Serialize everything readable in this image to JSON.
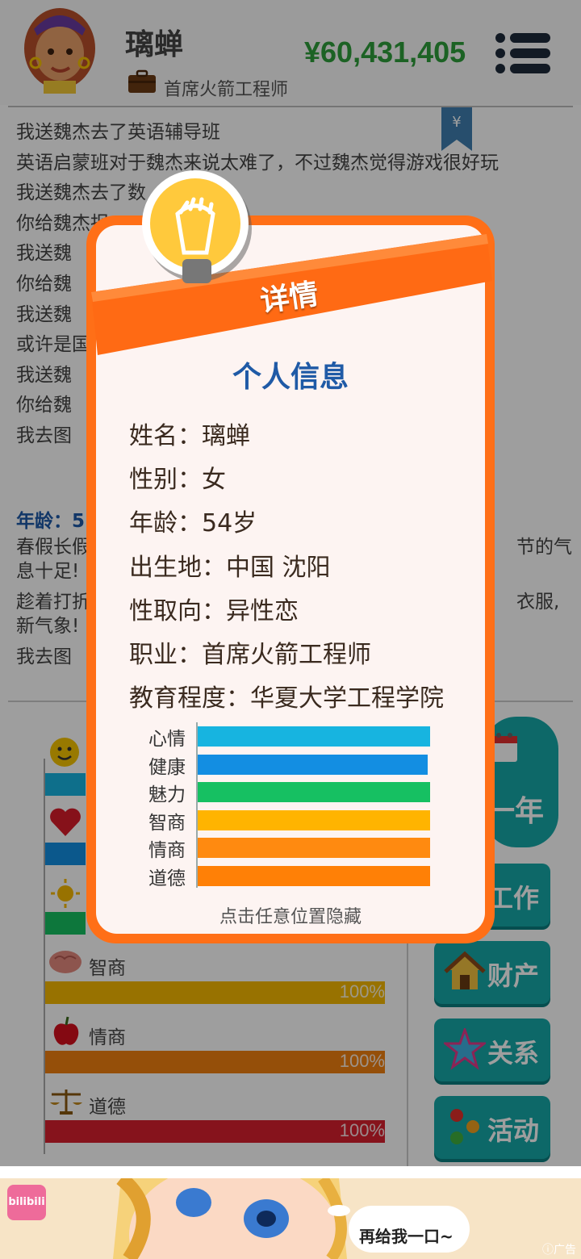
{
  "header": {
    "player_name": "璃蝉",
    "job_title": "首席火箭工程师",
    "money": "¥60,431,405",
    "icons": [
      "avatar",
      "briefcase-icon",
      "menu-icon"
    ]
  },
  "log": {
    "lines": [
      "我送魏杰去了英语辅导班",
      "英语启蒙班对于魏杰来说太难了，不过魏杰觉得游戏很好玩",
      "我送魏杰去了数",
      "你给魏杰报",
      "我送魏",
      "你给魏",
      "我送魏",
      "或许是国",
      "我送魏",
      "你给魏",
      "我去图"
    ],
    "age_title": "年龄：5",
    "paragraphs": [
      {
        "left": "春假长假",
        "right": "节的气",
        "line2": "息十足!"
      },
      {
        "left": "趁着打折",
        "right": "衣服,",
        "line2": "新气象!"
      },
      {
        "left": "我去图",
        "right": "",
        "line2": ""
      }
    ]
  },
  "stats": [
    {
      "label": "智商",
      "value": "100%",
      "color": "#f5b800",
      "icon": "brain-icon"
    },
    {
      "label": "情商",
      "value": "100%",
      "color": "#f08010",
      "icon": "apple-icon"
    },
    {
      "label": "道德",
      "value": "100%",
      "color": "#d8202e",
      "icon": "scales-icon"
    }
  ],
  "side_buttons": {
    "next_year": "一年",
    "work": "工作",
    "assets": "财产",
    "relations": "关系",
    "activities": "活动"
  },
  "modal": {
    "ribbon": "详情",
    "section_title": "个人信息",
    "info": [
      "姓名：璃蝉",
      "性别：女",
      "年龄：54岁",
      "出生地：中国 沈阳",
      "性取向：异性恋",
      "职业：首席火箭工程师",
      "教育程度：华夏大学工程学院"
    ],
    "bars": [
      {
        "label": "心情",
        "fraction": 1.0,
        "color": "#17b4e0"
      },
      {
        "label": "健康",
        "fraction": 0.99,
        "color": "#138ee2"
      },
      {
        "label": "魅力",
        "fraction": 1.0,
        "color": "#16c062"
      },
      {
        "label": "智商",
        "fraction": 1.0,
        "color": "#ffb400"
      },
      {
        "label": "情商",
        "fraction": 1.0,
        "color": "#ff8a10"
      },
      {
        "label": "道德",
        "fraction": 1.0,
        "color": "#ff8006"
      }
    ],
    "hint": "点击任意位置隐藏"
  },
  "ad": {
    "brand": "bilibili",
    "bubble": "再给我一口~",
    "tag": "广告"
  }
}
